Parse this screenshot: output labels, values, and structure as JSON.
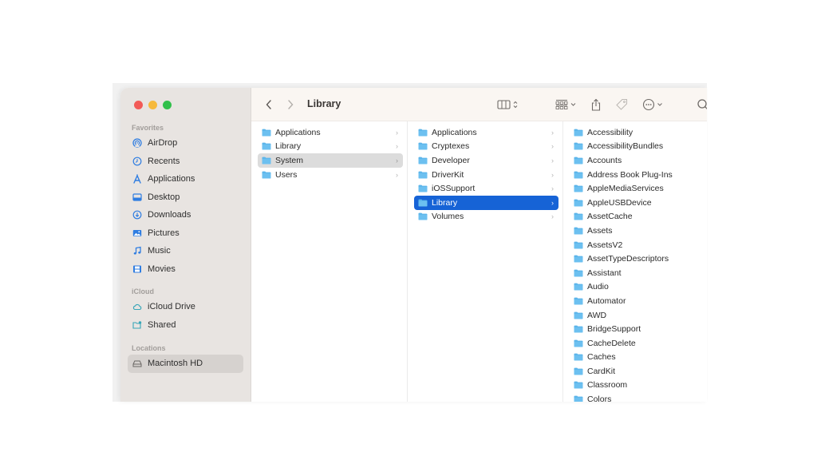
{
  "window": {
    "title": "Library",
    "traffic_lights": {
      "close": "#f25a57",
      "minimize": "#f6b93b",
      "maximize": "#31c04b"
    }
  },
  "toolbar": {
    "back_icon": "chevron-left-icon",
    "forward_icon": "chevron-right-icon",
    "title": "Library",
    "view_icon": "column-view-icon",
    "group_icon": "grid-group-icon",
    "share_icon": "share-icon",
    "tag_icon": "tag-icon",
    "more_icon": "ellipsis-circle-icon",
    "search_icon": "search-icon"
  },
  "sidebar": {
    "sections": [
      {
        "heading": "Favorites",
        "items": [
          {
            "label": "AirDrop",
            "icon": "airdrop-icon"
          },
          {
            "label": "Recents",
            "icon": "clock-icon"
          },
          {
            "label": "Applications",
            "icon": "applications-icon"
          },
          {
            "label": "Desktop",
            "icon": "desktop-icon"
          },
          {
            "label": "Downloads",
            "icon": "download-icon"
          },
          {
            "label": "Pictures",
            "icon": "photo-icon"
          },
          {
            "label": "Music",
            "icon": "music-note-icon"
          },
          {
            "label": "Movies",
            "icon": "film-icon"
          }
        ]
      },
      {
        "heading": "iCloud",
        "items": [
          {
            "label": "iCloud Drive",
            "icon": "cloud-icon"
          },
          {
            "label": "Shared",
            "icon": "shared-folder-icon"
          }
        ]
      },
      {
        "heading": "Locations",
        "items": [
          {
            "label": "Macintosh HD",
            "icon": "hard-drive-icon",
            "selected": true
          }
        ]
      }
    ]
  },
  "columns": [
    {
      "items": [
        "Applications",
        "Library",
        "System",
        "Users"
      ],
      "selected": "System"
    },
    {
      "items": [
        "Applications",
        "Cryptexes",
        "Developer",
        "DriverKit",
        "iOSSupport",
        "Library",
        "Volumes"
      ],
      "selected": "Library"
    },
    {
      "items": [
        "Accessibility",
        "AccessibilityBundles",
        "Accounts",
        "Address Book Plug-Ins",
        "AppleMediaServices",
        "AppleUSBDevice",
        "AssetCache",
        "Assets",
        "AssetsV2",
        "AssetTypeDescriptors",
        "Assistant",
        "Audio",
        "Automator",
        "AWD",
        "BridgeSupport",
        "CacheDelete",
        "Caches",
        "CardKit",
        "Classroom",
        "Colors"
      ],
      "selected": null
    }
  ],
  "colors": {
    "accent": "#1663d6",
    "folder": "#5ab4ea",
    "sidebar_icon": "#2f7de1"
  }
}
